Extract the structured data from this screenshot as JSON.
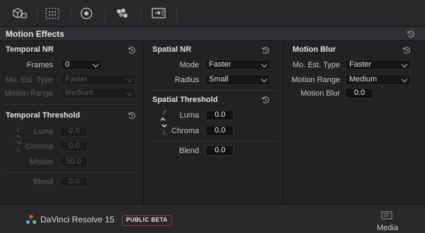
{
  "toolbar": {
    "buttons": [
      {
        "icon": "cube-3d-icon"
      },
      {
        "icon": "grid-dots-icon"
      },
      {
        "icon": "circle-target-icon"
      },
      {
        "icon": "color-dots-icon"
      },
      {
        "icon": "keyframe-export-icon"
      }
    ]
  },
  "header": {
    "title": "Motion Effects"
  },
  "temporal_nr": {
    "title": "Temporal NR",
    "frames_label": "Frames",
    "frames_value": "0",
    "mo_est_type_label": "Mo. Est. Type",
    "mo_est_type_value": "Faster",
    "motion_range_label": "Motion Range",
    "motion_range_value": "Medium"
  },
  "temporal_threshold": {
    "title": "Temporal Threshold",
    "luma_label": "Luma",
    "luma_value": "0.0",
    "chroma_label": "Chroma",
    "chroma_value": "0.0",
    "motion_label": "Motion",
    "motion_value": "50.0",
    "blend_label": "Blend",
    "blend_value": "0.0"
  },
  "spatial_nr": {
    "title": "Spatial NR",
    "mode_label": "Mode",
    "mode_value": "Faster",
    "radius_label": "Radius",
    "radius_value": "Small"
  },
  "spatial_threshold": {
    "title": "Spatial Threshold",
    "luma_label": "Luma",
    "luma_value": "0.0",
    "chroma_label": "Chroma",
    "chroma_value": "0.0",
    "blend_label": "Blend",
    "blend_value": "0.0"
  },
  "motion_blur": {
    "title": "Motion Blur",
    "mo_est_type_label": "Mo. Est. Type",
    "mo_est_type_value": "Faster",
    "motion_range_label": "Motion Range",
    "motion_range_value": "Medium",
    "motion_blur_label": "Motion Blur",
    "motion_blur_value": "0.0"
  },
  "footer": {
    "app_name": "DaVinci Resolve 15",
    "badge": "PUBLIC BETA",
    "media_label": "Media"
  },
  "colors": {
    "accent_beta_border": "#9b3046",
    "panel_bg": "#222225",
    "input_bg": "#121214"
  }
}
